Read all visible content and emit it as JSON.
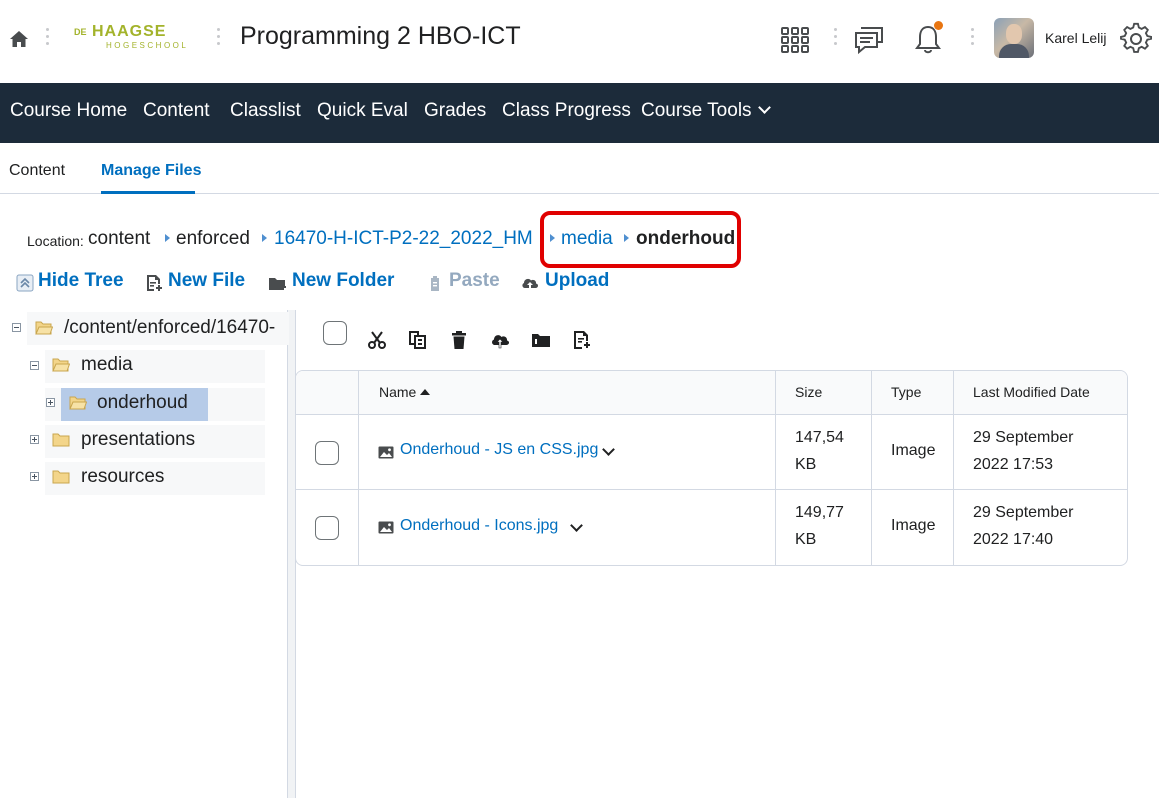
{
  "header": {
    "logo_line1_prefix": "DE",
    "logo_line1": "HAAGSE",
    "logo_line2": "HOGESCHOOL",
    "course_title": "Programming 2 HBO-ICT",
    "user_name": "Karel Lelij",
    "notification_color": "#e87511"
  },
  "nav": {
    "items": [
      "Course Home",
      "Content",
      "Classlist",
      "Quick Eval",
      "Grades",
      "Class Progress",
      "Course Tools"
    ]
  },
  "tabs": [
    "Content",
    "Manage Files"
  ],
  "location": {
    "label": "Location:",
    "crumbs": [
      "content",
      "enforced",
      "16470-H-ICT-P2-22_2022_HM",
      "media",
      "onderhoud"
    ]
  },
  "toolbar": {
    "hide_tree": "Hide Tree",
    "new_file": "New File",
    "new_folder": "New Folder",
    "paste": "Paste",
    "upload": "Upload"
  },
  "tree": {
    "root": "/content/enforced/16470-",
    "items": [
      "media",
      "onderhoud",
      "presentations",
      "resources"
    ]
  },
  "table": {
    "headers": [
      "Name",
      "Size",
      "Type",
      "Last Modified Date"
    ],
    "rows": [
      {
        "name": "Onderhoud - JS en CSS.jpg",
        "size_line1": "147,54",
        "size_line2": "KB",
        "type": "Image",
        "date_line1": "29 September",
        "date_line2": "2022 17:53"
      },
      {
        "name": "Onderhoud - Icons.jpg",
        "size_line1": "149,77",
        "size_line2": "KB",
        "type": "Image",
        "date_line1": "29 September",
        "date_line2": "2022 17:40"
      }
    ]
  },
  "colors": {
    "nav_bg": "#1c2b3a",
    "link": "#006fbf",
    "highlight": "#e00000",
    "tree_selected": "#b6cbe8"
  }
}
